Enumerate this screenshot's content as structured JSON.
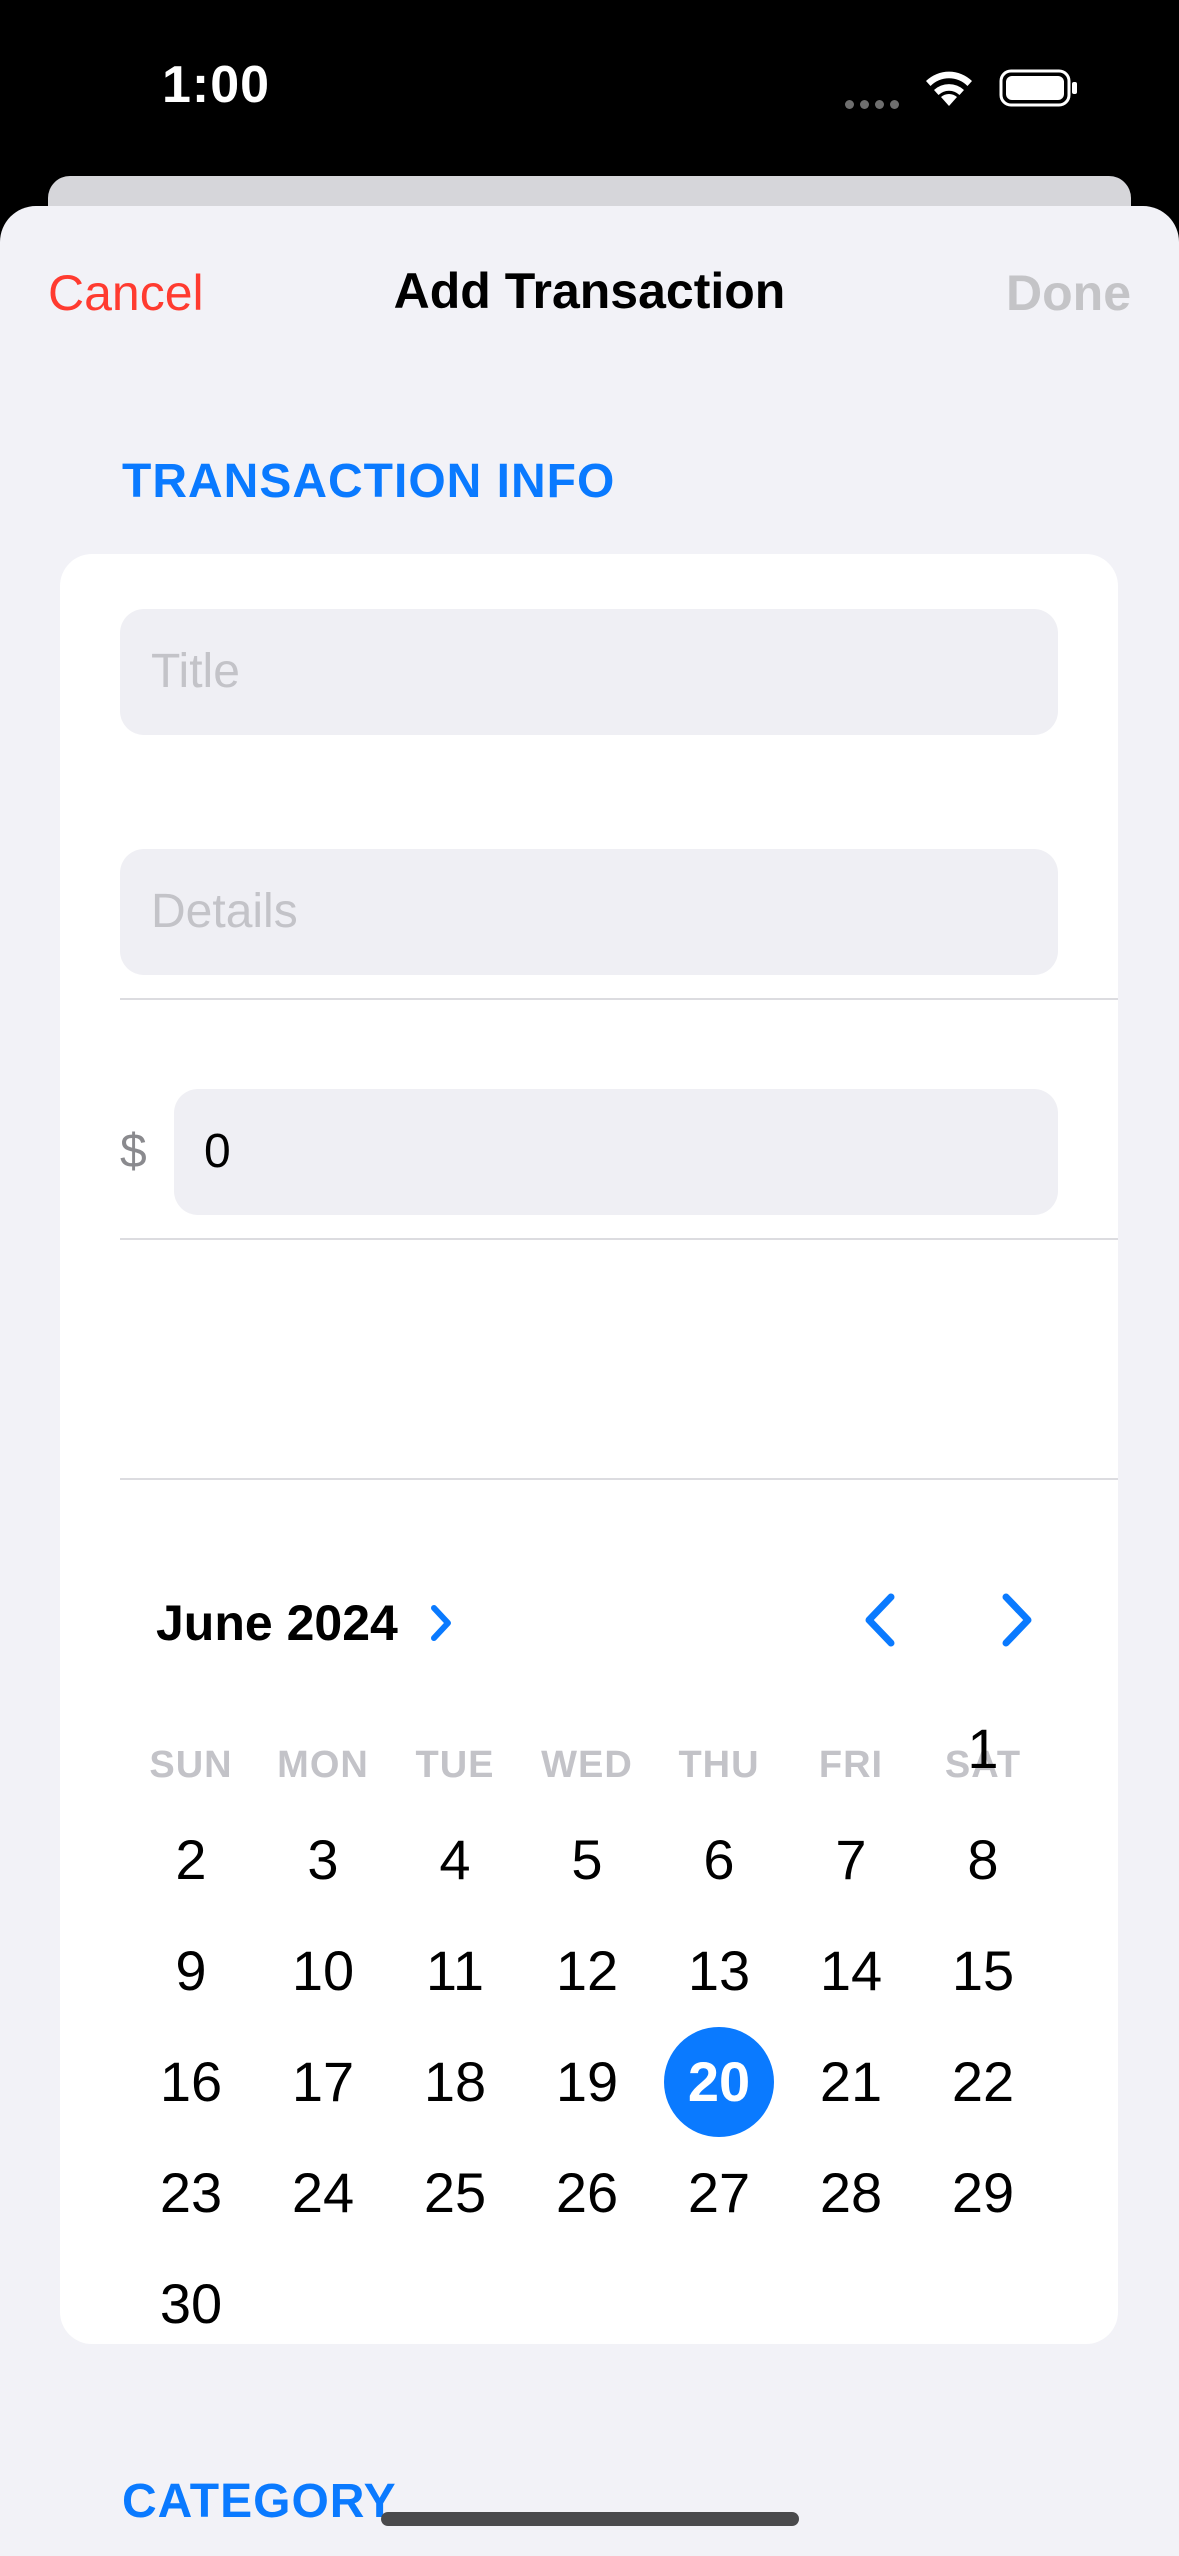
{
  "status_bar": {
    "time": "1:00"
  },
  "nav": {
    "cancel": "Cancel",
    "title": "Add Transaction",
    "done": "Done"
  },
  "sections": {
    "transaction_info": "TRANSACTION INFO",
    "category": "CATEGORY"
  },
  "fields": {
    "title_placeholder": "Title",
    "details_placeholder": "Details",
    "currency_symbol": "$",
    "amount_value": "0"
  },
  "calendar": {
    "month_label": "June 2024",
    "weekdays": [
      "SUN",
      "MON",
      "TUE",
      "WED",
      "THU",
      "FRI",
      "SAT"
    ],
    "days": [
      "1",
      "2",
      "3",
      "4",
      "5",
      "6",
      "7",
      "8",
      "9",
      "10",
      "11",
      "12",
      "13",
      "14",
      "15",
      "16",
      "17",
      "18",
      "19",
      "20",
      "21",
      "22",
      "23",
      "24",
      "25",
      "26",
      "27",
      "28",
      "29",
      "30"
    ],
    "selected_day": "20"
  },
  "colors": {
    "accent": "#0a7aff",
    "destructive": "#ff3b30",
    "disabled": "#c4c4c7",
    "background": "#f2f2f7"
  }
}
